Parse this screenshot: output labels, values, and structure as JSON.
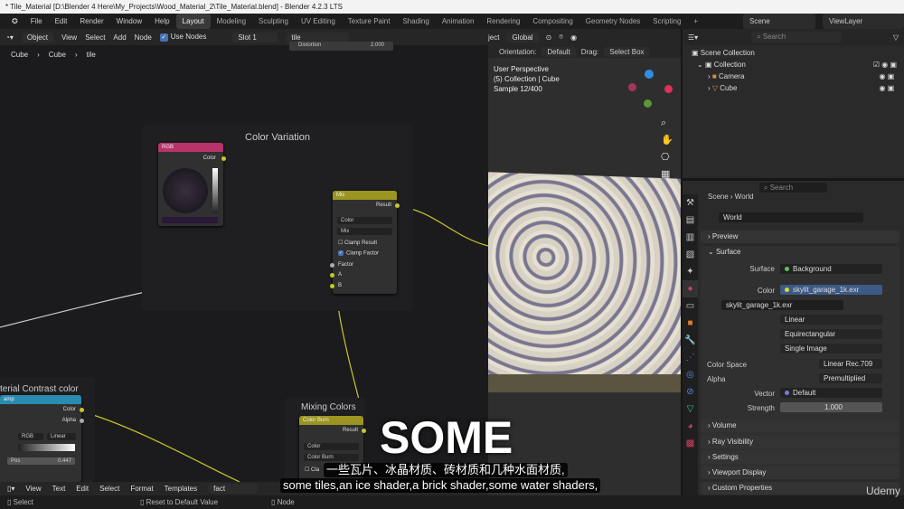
{
  "window_title": "* Tile_Material [D:\\Blender 4 Here\\My_Projects\\Wood_Material_2\\Tile_Material.blend] - Blender 4.2.3 LTS",
  "menu": [
    "File",
    "Edit",
    "Render",
    "Window",
    "Help"
  ],
  "workspaces": [
    "Layout",
    "Modeling",
    "Sculpting",
    "UV Editing",
    "Texture Paint",
    "Shading",
    "Animation",
    "Rendering",
    "Compositing",
    "Geometry Nodes",
    "Scripting",
    "+"
  ],
  "active_workspace": "Layout",
  "scene": "Scene",
  "view_layer": "ViewLayer",
  "node_header": {
    "mode": "Object",
    "items": [
      "View",
      "Select",
      "Add",
      "Node"
    ],
    "use_nodes": "Use Nodes",
    "slot": "Slot 1",
    "material": "tile",
    "popup_label": "Distortion",
    "popup_value": "2.000"
  },
  "breadcrumb": [
    "Cube",
    "Cube",
    "tile"
  ],
  "frames": {
    "color_variation": "Color Variation",
    "contrast": "terial Contrast color",
    "mixing": "Mixing Colors"
  },
  "rgb_node": {
    "title": "RGB",
    "out": "Color"
  },
  "mix_node": {
    "title": "Mix",
    "out": "Result",
    "type": "Color",
    "blend": "Mix",
    "clamp_result": "Clamp Result",
    "clamp_factor": "Clamp Factor",
    "inputs": [
      "Factor",
      "A",
      "B"
    ]
  },
  "ramp_node": {
    "title": "amp",
    "outs": [
      "Color",
      "Alpha"
    ],
    "mode": "RGB",
    "interp": "Linear",
    "pos_label": "Pos",
    "pos_value": "0.447"
  },
  "burn_node": {
    "title": "Color Burn",
    "out": "Result",
    "type": "Color",
    "blend": "Color Burn",
    "clamp": "Cla"
  },
  "viewport": {
    "menu": "ject",
    "transform": "Global",
    "orientation_label": "Orientation:",
    "orientation": "Default",
    "drag_label": "Drag:",
    "drag": "Select Box",
    "info": [
      "User Perspective",
      "(5) Collection | Cube",
      "Sample 12/400"
    ]
  },
  "outliner": {
    "search": "Search",
    "items": [
      "Scene Collection",
      "Collection",
      "Camera",
      "Cube"
    ]
  },
  "properties": {
    "search": "Search",
    "crumb": [
      "Scene",
      "World"
    ],
    "world": "World",
    "panels": {
      "preview": "Preview",
      "surface": "Surface",
      "volume": "Volume",
      "ray": "Ray Visibility",
      "settings": "Settings",
      "viewport_display": "Viewport Display",
      "custom": "Custom Properties"
    },
    "surface_label": "Surface",
    "surface": "Background",
    "color_label": "Color",
    "color": "skylit_garage_1k.exr",
    "image": "skylit_garage_1k.exr",
    "interp": "Linear",
    "projection": "Equirectangular",
    "source": "Single Image",
    "colorspace_label": "Color Space",
    "colorspace": "Linear Rec.709",
    "alpha_label": "Alpha",
    "alpha": "Premultiplied",
    "vector_label": "Vector",
    "vector": "Default",
    "strength_label": "Strength",
    "strength": "1.000"
  },
  "text_editor": {
    "items": [
      "View",
      "Text",
      "Edit",
      "Select",
      "Format",
      "Templates"
    ],
    "file": "fact"
  },
  "status": {
    "select": "Select",
    "reset": "Reset to Default Value",
    "node": "Node"
  },
  "subtitles": {
    "big": "SOME",
    "zh": "一些瓦片、冰晶材质、砖材质和几种水面材质,",
    "en": "some tiles,an ice shader,a brick shader,some water shaders,"
  },
  "watermark": "Udemy",
  "colors": {
    "accent": "#4772b3",
    "wire": "#c7c729",
    "rgb_header": "#b8336a",
    "mix_header": "#9c9420",
    "ramp_header": "#2a8bb0"
  }
}
